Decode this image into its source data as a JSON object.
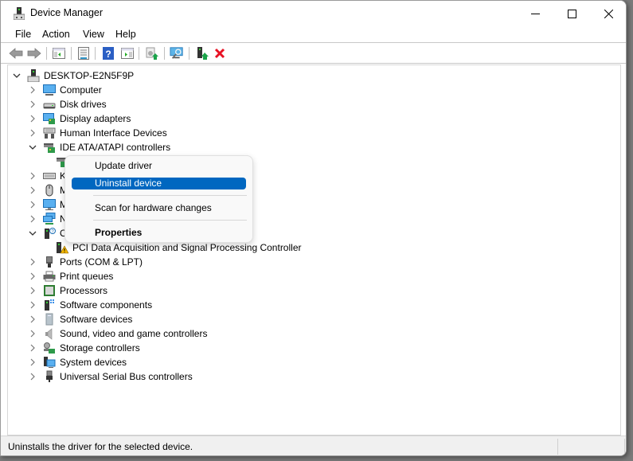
{
  "window": {
    "title": "Device Manager",
    "controls": {
      "minimize": "minimize-icon",
      "maximize": "maximize-icon",
      "close": "close-icon"
    }
  },
  "menubar": {
    "items": [
      {
        "label": "File"
      },
      {
        "label": "Action"
      },
      {
        "label": "View"
      },
      {
        "label": "Help"
      }
    ]
  },
  "toolbar": {
    "buttons": [
      {
        "name": "back",
        "icon": "arrow-left-icon"
      },
      {
        "name": "forward",
        "icon": "arrow-right-icon"
      },
      {
        "name": "show-hide-console-tree",
        "icon": "console-tree-icon"
      },
      {
        "name": "properties",
        "icon": "properties-icon"
      },
      {
        "name": "help",
        "icon": "help-icon"
      },
      {
        "name": "show-action-pane",
        "icon": "action-pane-icon"
      },
      {
        "name": "update-driver",
        "icon": "update-driver-icon"
      },
      {
        "name": "scan-hardware",
        "icon": "scan-monitor-icon"
      },
      {
        "name": "add-legacy-hardware",
        "icon": "add-device-icon"
      },
      {
        "name": "uninstall-device",
        "icon": "red-x-icon"
      }
    ]
  },
  "tree": {
    "root": {
      "label": "DESKTOP-E2N5F9P",
      "expanded": true
    },
    "categories": [
      {
        "label": "Computer",
        "expanded": false,
        "icon": "computer-icon"
      },
      {
        "label": "Disk drives",
        "expanded": false,
        "icon": "disk-drive-icon"
      },
      {
        "label": "Display adapters",
        "expanded": false,
        "icon": "display-adapter-icon"
      },
      {
        "label": "Human Interface Devices",
        "expanded": false,
        "icon": "hid-icon"
      },
      {
        "label": "IDE ATA/ATAPI controllers",
        "expanded": true,
        "icon": "ide-controller-icon"
      },
      {
        "label": "",
        "child": true,
        "icon": "ide-controller-icon"
      },
      {
        "label": "K",
        "expanded": false,
        "icon": "keyboard-icon"
      },
      {
        "label": "M",
        "expanded": false,
        "icon": "mouse-icon"
      },
      {
        "label": "M",
        "expanded": false,
        "icon": "monitor-icon"
      },
      {
        "label": "N",
        "expanded": false,
        "icon": "network-icon"
      },
      {
        "label": "O",
        "expanded": true,
        "icon": "unknown-device-icon"
      },
      {
        "label": "PCI Data Acquisition and Signal Processing Controller",
        "child": true,
        "icon": "warning-device-icon"
      },
      {
        "label": "Ports (COM & LPT)",
        "expanded": false,
        "icon": "port-icon"
      },
      {
        "label": "Print queues",
        "expanded": false,
        "icon": "printer-icon"
      },
      {
        "label": "Processors",
        "expanded": false,
        "icon": "processor-icon"
      },
      {
        "label": "Software components",
        "expanded": false,
        "icon": "software-component-icon"
      },
      {
        "label": "Software devices",
        "expanded": false,
        "icon": "software-device-icon"
      },
      {
        "label": "Sound, video and game controllers",
        "expanded": false,
        "icon": "speaker-icon"
      },
      {
        "label": "Storage controllers",
        "expanded": false,
        "icon": "storage-controller-icon"
      },
      {
        "label": "System devices",
        "expanded": false,
        "icon": "system-device-icon"
      },
      {
        "label": "Universal Serial Bus controllers",
        "expanded": false,
        "icon": "usb-icon"
      }
    ]
  },
  "context_menu": {
    "items": [
      {
        "label": "Update driver",
        "highlighted": false
      },
      {
        "label": "Uninstall device",
        "highlighted": true
      },
      {
        "label": "Scan for hardware changes",
        "highlighted": false
      },
      {
        "label": "Properties",
        "highlighted": false,
        "bold": true
      }
    ]
  },
  "statusbar": {
    "text": "Uninstalls the driver for the selected device."
  },
  "colors": {
    "highlight": "#0067c0",
    "close_red": "#e81123",
    "warning_yellow": "#f5b700"
  }
}
